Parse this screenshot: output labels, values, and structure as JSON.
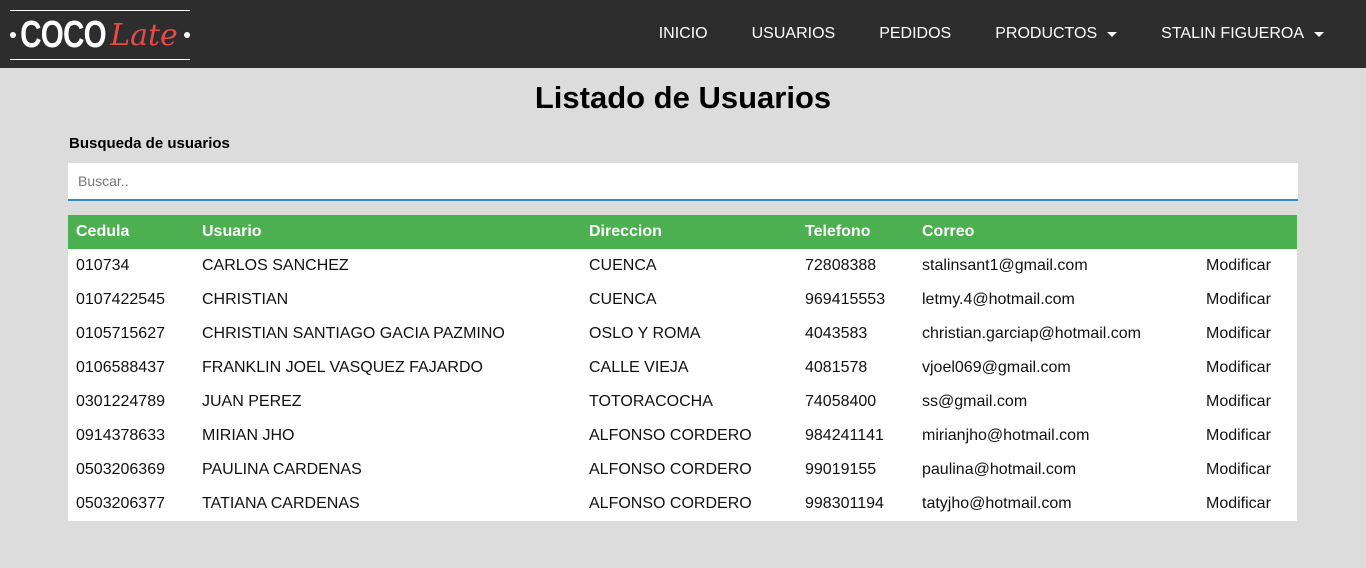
{
  "brand": {
    "part1": "COCO",
    "part2": "Late"
  },
  "nav": [
    {
      "label": "INICIO"
    },
    {
      "label": "USUARIOS"
    },
    {
      "label": "PEDIDOS"
    },
    {
      "label": "PRODUCTOS",
      "dropdown": true
    },
    {
      "label": "STALIN FIGUEROA",
      "dropdown": true
    }
  ],
  "page": {
    "title": "Listado de Usuarios",
    "search_label": "Busqueda de usuarios",
    "search_placeholder": "Buscar..",
    "search_value": ""
  },
  "table": {
    "headers": [
      "Cedula",
      "Usuario",
      "Direccion",
      "Telefono",
      "Correo",
      ""
    ],
    "action_label": "Modificar",
    "rows": [
      [
        "010734",
        "CARLOS SANCHEZ",
        "CUENCA",
        "72808388",
        "stalinsant1@gmail.com"
      ],
      [
        "0107422545",
        "CHRISTIAN",
        "CUENCA",
        "969415553",
        "letmy.4@hotmail.com"
      ],
      [
        "0105715627",
        "CHRISTIAN SANTIAGO GACIA PAZMINO",
        "OSLO Y ROMA",
        "4043583",
        "christian.garciap@hotmail.com"
      ],
      [
        "0106588437",
        "FRANKLIN JOEL VASQUEZ FAJARDO",
        "CALLE VIEJA",
        "4081578",
        "vjoel069@gmail.com"
      ],
      [
        "0301224789",
        "JUAN PEREZ",
        "TOTORACOCHA",
        "74058400",
        "ss@gmail.com"
      ],
      [
        "0914378633",
        "MIRIAN JHO",
        "ALFONSO CORDERO",
        "984241141",
        "mirianjho@hotmail.com"
      ],
      [
        "0503206369",
        "PAULINA CARDENAS",
        "ALFONSO CORDERO",
        "99019155",
        "paulina@hotmail.com"
      ],
      [
        "0503206377",
        "TATIANA CARDENAS",
        "ALFONSO CORDERO",
        "998301194",
        "tatyjho@hotmail.com"
      ]
    ]
  },
  "colors": {
    "navbar": "#2d2d2d",
    "header": "#4caf50",
    "accent": "#e84a4a",
    "focus": "#2e8bcd"
  }
}
